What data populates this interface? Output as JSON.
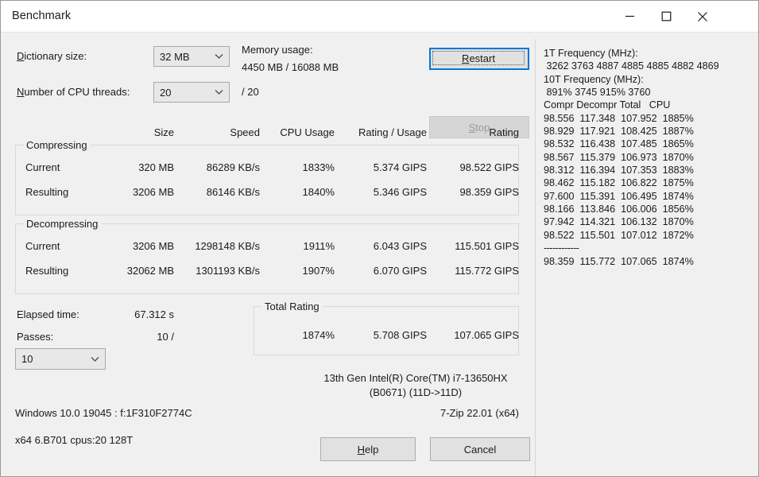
{
  "window": {
    "title": "Benchmark",
    "controls": [
      {
        "name": "minimize",
        "glyph": "minimize-icon"
      },
      {
        "name": "maximize",
        "glyph": "maximize-icon"
      },
      {
        "name": "close",
        "glyph": "close-icon"
      }
    ]
  },
  "settings": {
    "dictionary_label": "Dictionary size:",
    "dictionary_value": "32 MB",
    "threads_label": "Number of CPU threads:",
    "threads_value": "20",
    "threads_max": "/ 20",
    "memory_label": "Memory usage:",
    "memory_value": "4450 MB / 16088 MB"
  },
  "actions": {
    "restart": "Restart",
    "stop": "Stop",
    "help": "Help",
    "cancel": "Cancel"
  },
  "table": {
    "headers": {
      "size": "Size",
      "speed": "Speed",
      "cpu_usage": "CPU Usage",
      "rating_usage": "Rating / Usage",
      "rating": "Rating"
    },
    "compressing": {
      "title": "Compressing",
      "rows": [
        {
          "label": "Current",
          "size": "320 MB",
          "speed": "86289 KB/s",
          "cpu_usage": "1833%",
          "rating_usage": "5.374 GIPS",
          "rating": "98.522 GIPS"
        },
        {
          "label": "Resulting",
          "size": "3206 MB",
          "speed": "86146 KB/s",
          "cpu_usage": "1840%",
          "rating_usage": "5.346 GIPS",
          "rating": "98.359 GIPS"
        }
      ]
    },
    "decompressing": {
      "title": "Decompressing",
      "rows": [
        {
          "label": "Current",
          "size": "3206 MB",
          "speed": "1298148 KB/s",
          "cpu_usage": "1911%",
          "rating_usage": "6.043 GIPS",
          "rating": "115.501 GIPS"
        },
        {
          "label": "Resulting",
          "size": "32062 MB",
          "speed": "1301193 KB/s",
          "cpu_usage": "1907%",
          "rating_usage": "6.070 GIPS",
          "rating": "115.772 GIPS"
        }
      ]
    }
  },
  "status": {
    "elapsed_label": "Elapsed time:",
    "elapsed_value": "67.312 s",
    "passes_label": "Passes:",
    "passes_value": "10 /",
    "passes_select": "10"
  },
  "total_rating": {
    "title": "Total Rating",
    "cpu_usage": "1874%",
    "rating_usage": "5.708 GIPS",
    "rating": "107.065 GIPS"
  },
  "footer": {
    "cpu_line1": "13th Gen Intel(R) Core(TM) i7-13650HX",
    "cpu_line2": "(B0671) (11D->11D)",
    "os_line": "Windows 10.0 19045 : f:1F310F2774C",
    "version_line": "7-Zip 22.01 (x64)",
    "arch_line": "x64 6.B701 cpus:20 128T"
  },
  "log": {
    "freq_1t_label": "1T Frequency (MHz):",
    "freq_1t_values": " 3262 3763 4887 4885 4885 4882 4869",
    "freq_10t_label": "10T Frequency (MHz):",
    "freq_10t_values": " 891% 3745 915% 3760",
    "columns": "Compr Decompr Total   CPU",
    "rows": [
      "98.556  117.348  107.952  1885%",
      "98.929  117.921  108.425  1887%",
      "98.532  116.438  107.485  1865%",
      "98.567  115.379  106.973  1870%",
      "98.312  116.394  107.353  1883%",
      "98.462  115.182  106.822  1875%",
      "97.600  115.391  106.495  1874%",
      "98.166  113.846  106.006  1856%",
      "97.942  114.321  106.132  1870%",
      "98.522  115.501  107.012  1872%"
    ],
    "separator": "------------",
    "totals": "98.359  115.772  107.065  1874%"
  },
  "colors": {
    "window_bg": "#f0f0f0",
    "titlebar_bg": "#ffffff",
    "focus_accent": "#0078d7",
    "text": "#1a1a1a",
    "group_border": "#d8d8d8"
  }
}
